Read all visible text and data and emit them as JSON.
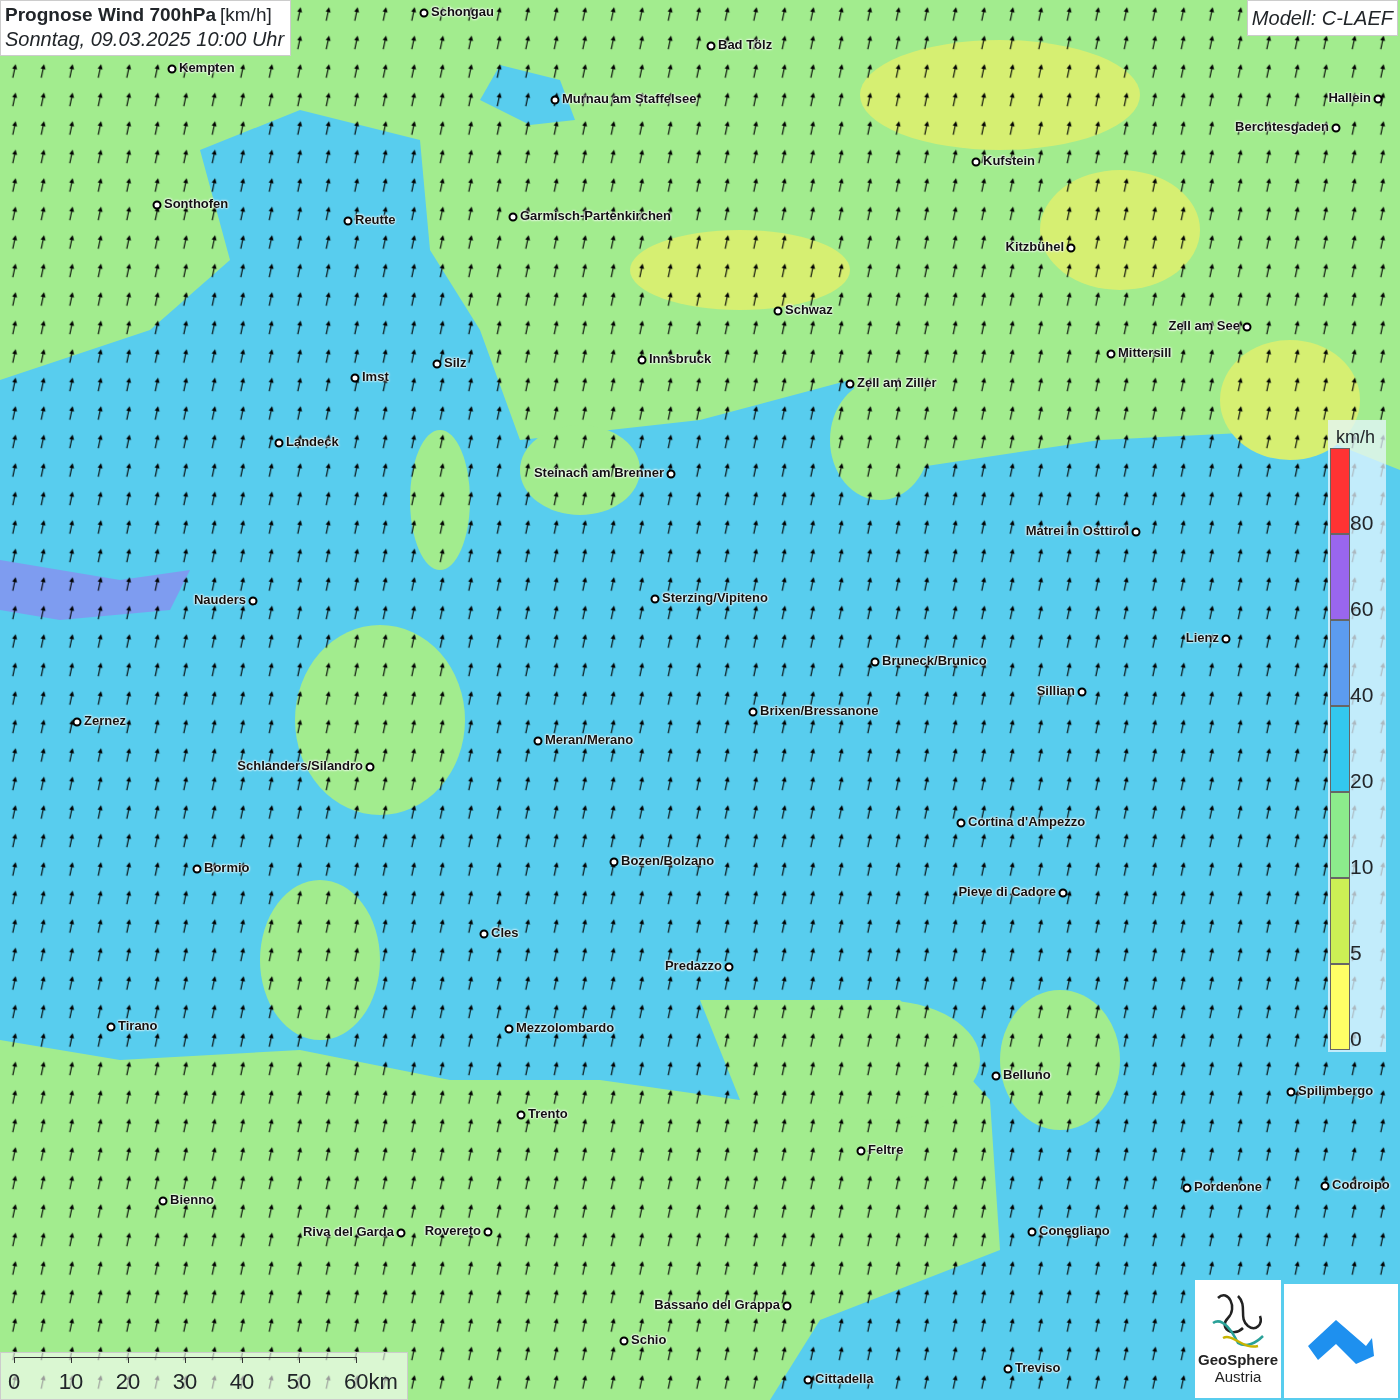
{
  "header": {
    "title": "Prognose Wind 700hPa",
    "unit": "[km/h]",
    "datetime": "Sonntag, 09.03.2025 10:00 Uhr"
  },
  "model": "Modell: C-LAEF",
  "cities": [
    {
      "name": "Schongau"
    },
    {
      "name": "Bad Tölz"
    },
    {
      "name": "Kempten"
    },
    {
      "name": "Murnau am Staffelsee"
    },
    {
      "name": "Hallein"
    },
    {
      "name": "Berchtesgaden"
    },
    {
      "name": "Kufstein"
    },
    {
      "name": "Sonthofen"
    },
    {
      "name": "Reutte"
    },
    {
      "name": "Garmisch-Partenkirchen"
    },
    {
      "name": "Kitzbühel"
    },
    {
      "name": "Schwaz"
    },
    {
      "name": "Zell am See"
    },
    {
      "name": "Mittersill"
    },
    {
      "name": "Innsbruck"
    },
    {
      "name": "Imst"
    },
    {
      "name": "Silz"
    },
    {
      "name": "Zell am Ziller"
    },
    {
      "name": "Landeck"
    },
    {
      "name": "Steinach am Brenner"
    },
    {
      "name": "Matrei in Osttirol"
    },
    {
      "name": "Nauders"
    },
    {
      "name": "Sterzing/Vipiteno"
    },
    {
      "name": "Lienz"
    },
    {
      "name": "Bruneck/Brunico"
    },
    {
      "name": "Sillian"
    },
    {
      "name": "Zernez"
    },
    {
      "name": "Brixen/Bressanone"
    },
    {
      "name": "Meran/Merano"
    },
    {
      "name": "Schlanders/Silandro"
    },
    {
      "name": "Cortina d'Ampezzo"
    },
    {
      "name": "Bozen/Bolzano"
    },
    {
      "name": "Bormio"
    },
    {
      "name": "Pieve di Cadore"
    },
    {
      "name": "Cles"
    },
    {
      "name": "Predazzo"
    },
    {
      "name": "Tirano"
    },
    {
      "name": "Mezzolombardo"
    },
    {
      "name": "Belluno"
    },
    {
      "name": "Spilimbergo"
    },
    {
      "name": "Trento"
    },
    {
      "name": "Feltre"
    },
    {
      "name": "Pordenone"
    },
    {
      "name": "Codroipo"
    },
    {
      "name": "Bienno"
    },
    {
      "name": "Riva del Garda"
    },
    {
      "name": "Rovereto"
    },
    {
      "name": "Conegliano"
    },
    {
      "name": "Bassano del Grappa"
    },
    {
      "name": "Schio"
    },
    {
      "name": "Treviso"
    },
    {
      "name": "Cittadella"
    }
  ],
  "legend": {
    "unit": "km/h",
    "bands": [
      {
        "label": "80",
        "color": "#ff3333"
      },
      {
        "label": "60",
        "color": "#9966ee"
      },
      {
        "label": "40",
        "color": "#5c9cf0"
      },
      {
        "label": "20",
        "color": "#33c8ee"
      },
      {
        "label": "10",
        "color": "#8cec8c"
      },
      {
        "label": "5",
        "color": "#ccf055"
      },
      {
        "label": "0",
        "color": "#ffff66"
      }
    ]
  },
  "scale_bar": {
    "ticks": [
      "0",
      "10",
      "20",
      "30",
      "40",
      "50",
      "60km"
    ]
  },
  "logo": {
    "name": "GeoSphere",
    "subtitle": "Austria"
  }
}
